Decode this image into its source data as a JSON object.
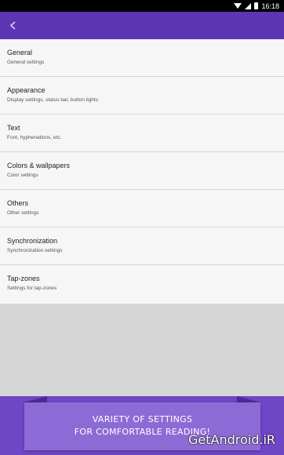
{
  "status_bar": {
    "time": "16:18",
    "icons": [
      "wifi-icon",
      "signal-icon",
      "battery-icon"
    ]
  },
  "toolbar": {
    "color": "#5c35b5",
    "back_icon": "chevron-left-icon"
  },
  "settings": {
    "items": [
      {
        "title": "General",
        "subtitle": "General settings"
      },
      {
        "title": "Appearance",
        "subtitle": "Display settings, status bar, button lights"
      },
      {
        "title": "Text",
        "subtitle": "Font, hyphenations, etc."
      },
      {
        "title": "Colors & wallpapers",
        "subtitle": "Color settings"
      },
      {
        "title": "Others",
        "subtitle": "Other settings"
      },
      {
        "title": "Synchronization",
        "subtitle": "Synchronization settings"
      },
      {
        "title": "Tap-zones",
        "subtitle": "Settings for tap-zones"
      }
    ]
  },
  "banner": {
    "line1": "VARIETY OF SETTINGS",
    "line2": "FOR COMFORTABLE READING!",
    "color": "#8d6bd6"
  },
  "watermark": {
    "text": "GetAndroid.iR"
  }
}
